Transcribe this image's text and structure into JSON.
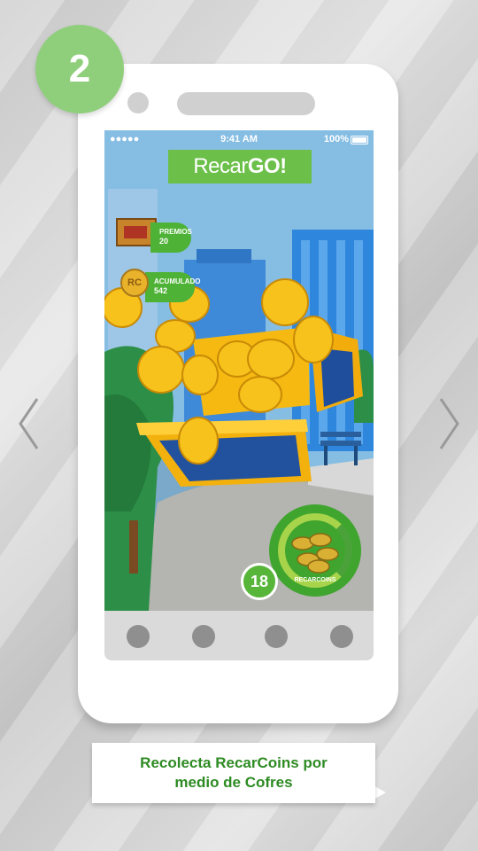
{
  "step": {
    "number": "2"
  },
  "statusbar": {
    "signal": "●●●●● ",
    "time": "9:41 AM",
    "battery": "100%"
  },
  "app": {
    "logo_light": "Recar",
    "logo_bold": "GO!"
  },
  "hud": {
    "prizes_label": "PREMIOS",
    "prizes_value": "20",
    "accumulated_label": "ACUMULADO",
    "accumulated_value": "542",
    "coin_emblem": "RC"
  },
  "meter": {
    "label": "RECARCOINS",
    "count": "18"
  },
  "caption": {
    "line1": "Recolecta RecarCoins por",
    "line2": "medio de Cofres"
  },
  "colors": {
    "accent_green": "#4db236",
    "badge_green": "#8fcf7c",
    "caption_text": "#2e8b23",
    "sky": "#7fb4dc"
  },
  "icons": {
    "prev": "chevron-left-icon",
    "next": "chevron-right-icon",
    "wifi": "wifi-icon",
    "battery": "battery-icon"
  }
}
